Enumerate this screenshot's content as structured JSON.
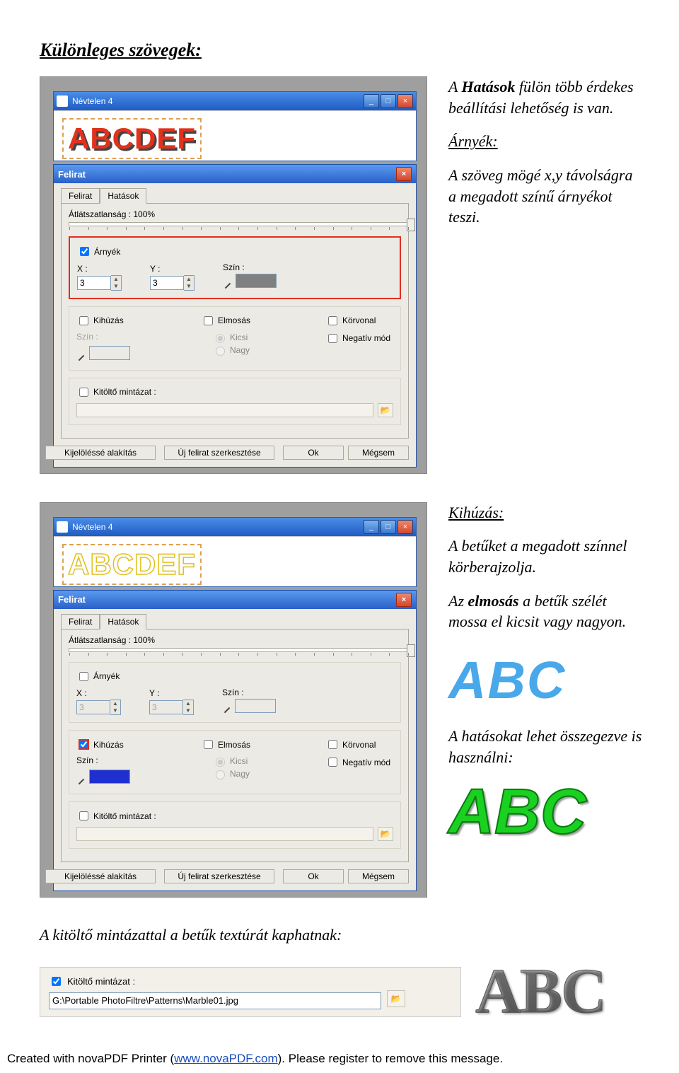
{
  "page_title": "Különleges szövegek:",
  "section1": {
    "p1_a": "A ",
    "p1_b": "Hatások",
    "p1_c": " fülön több érdekes beállítási lehetőség is van.",
    "sub": "Árnyék:",
    "p2": "A szöveg mögé x,y távolságra a megadott színű árnyékot teszi."
  },
  "section2": {
    "sub": "Kihúzás:",
    "p1": "A betűket a megadott színnel körberajzolja.",
    "p2_a": "Az ",
    "p2_b": "elmosás",
    "p2_c": " a betűk szélét mossa el kicsit vagy nagyon.",
    "abc_blue": "ABC",
    "p3": "A hatásokat lehet összegezve is használni:",
    "abc_green": "ABC"
  },
  "bottom": {
    "text": "A kitöltő mintázattal a betűk textúrát kaphatnak:",
    "check": "Kitöltő mintázat :",
    "path": "G:\\Portable PhotoFiltre\\Patterns\\Marble01.jpg",
    "abc": "ABC"
  },
  "dialog": {
    "doc_title": "Névtelen 4",
    "canvas_text": "ABCDEF",
    "dlg_title": "Felirat",
    "tab1": "Felirat",
    "tab2": "Hatások",
    "opacity_label": "Átlátszatlanság : 100%",
    "shadow": "Árnyék",
    "x": "X :",
    "y": "Y :",
    "x_val": "3",
    "y_val": "3",
    "color": "Szín :",
    "kihúzás": "Kihúzás",
    "elmosás": "Elmosás",
    "kicsi": "Kicsi",
    "nagy": "Nagy",
    "körvonal": "Körvonal",
    "negatív": "Negatív mód",
    "mintázat": "Kitöltő mintázat :",
    "btn1": "Kijelöléssé alakítás",
    "btn2": "Új felirat szerkesztése",
    "ok": "Ok",
    "cancel": "Mégsem"
  },
  "footer": {
    "t1": "Created with novaPDF Printer (",
    "link": "www.novaPDF.com",
    "t2": "). Please register to remove this message."
  }
}
